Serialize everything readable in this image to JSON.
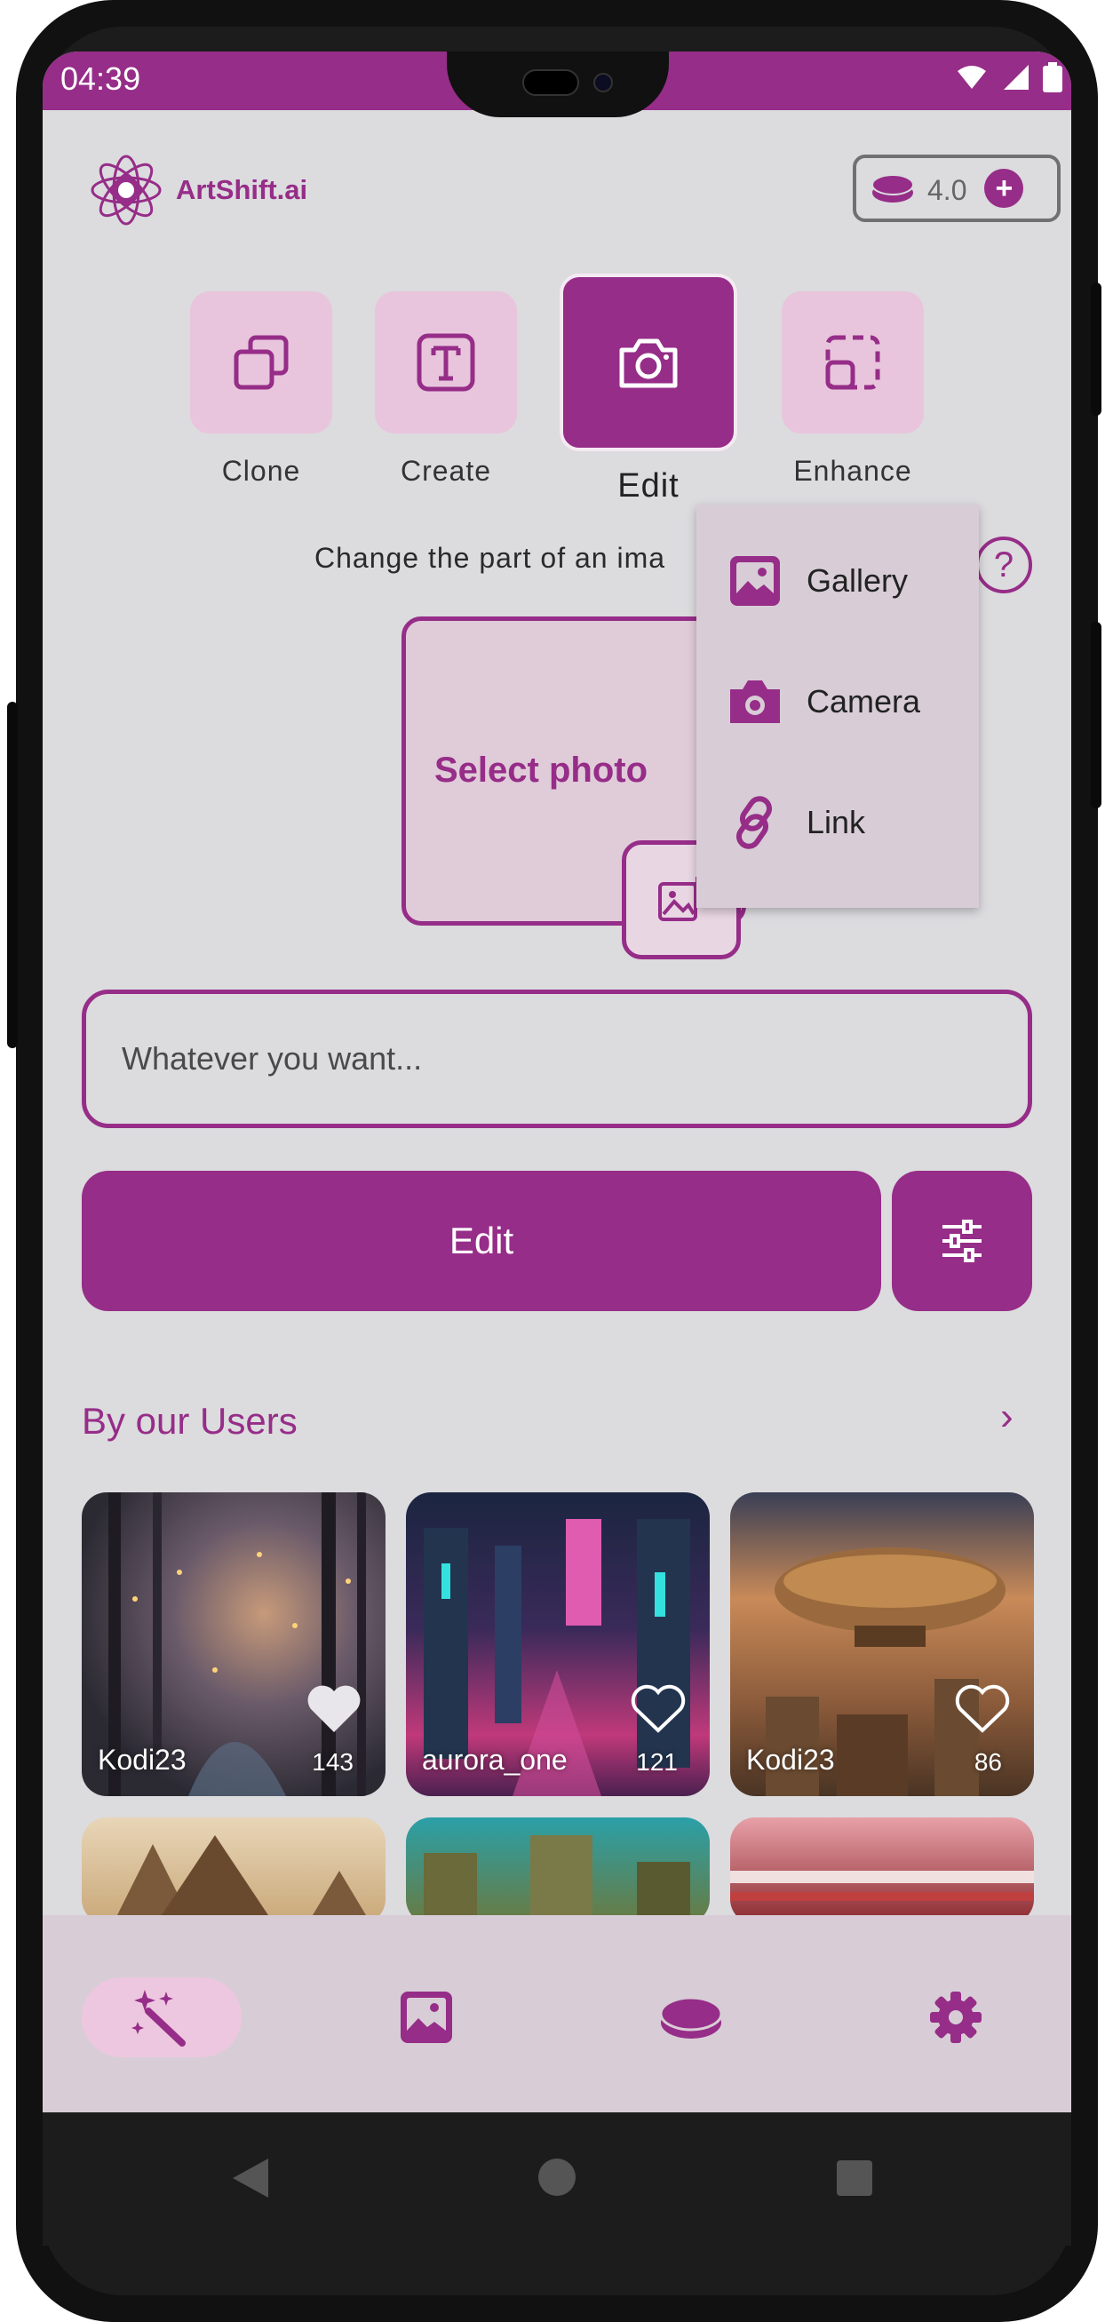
{
  "status": {
    "time": "04:39"
  },
  "app": {
    "name": "ArtShift.ai",
    "credits": "4.0",
    "plus": "+"
  },
  "modes": [
    {
      "label": "Clone",
      "icon": "copy-icon"
    },
    {
      "label": "Create",
      "icon": "text-box-icon"
    },
    {
      "label": "Edit",
      "icon": "camera-icon"
    },
    {
      "label": "Enhance",
      "icon": "crop-expand-icon"
    }
  ],
  "active_mode": "Edit",
  "description": "Change the part of an ima",
  "help": "?",
  "photo": {
    "label": "Select photo"
  },
  "source_menu": [
    {
      "label": "Gallery",
      "icon": "gallery-icon"
    },
    {
      "label": "Camera",
      "icon": "camera-icon"
    },
    {
      "label": "Link",
      "icon": "link-icon"
    }
  ],
  "prompt": {
    "placeholder": "Whatever you want..."
  },
  "edit_button": "Edit",
  "gallery": {
    "title": "By our Users",
    "more": "›",
    "items": [
      {
        "user": "Kodi23",
        "likes": "143"
      },
      {
        "user": "aurora_one",
        "likes": "121"
      },
      {
        "user": "Kodi23",
        "likes": "86"
      }
    ]
  },
  "colors": {
    "accent": "#962d88",
    "tile": "#e8c5dd",
    "background": "#dcdbde",
    "nav": "#d8cdd6"
  }
}
